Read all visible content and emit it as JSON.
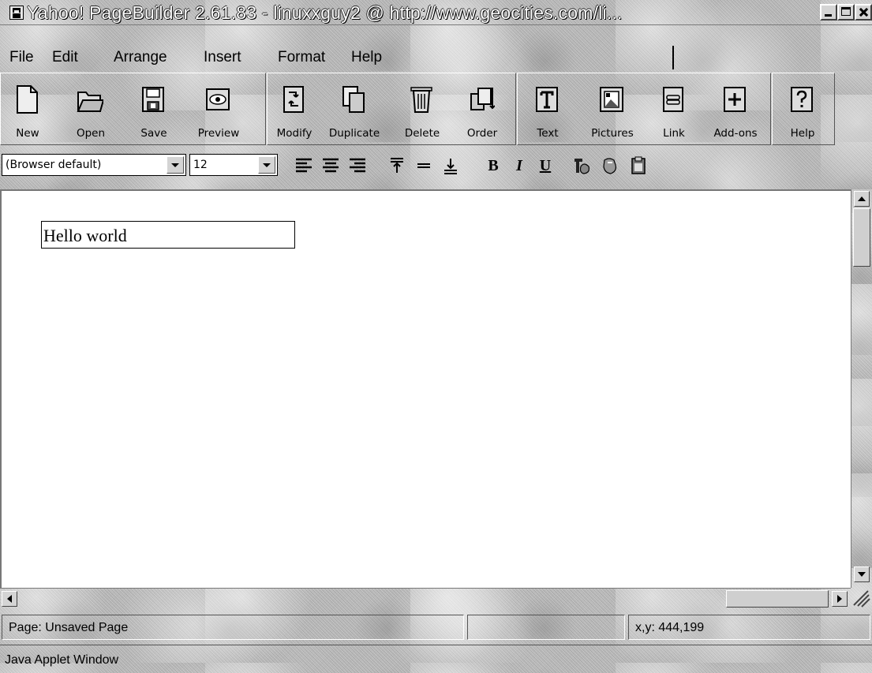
{
  "window": {
    "title": "Yahoo! PageBuilder 2.61.83 - linuxxguy2 @ http://www.geocities.com/li...",
    "icon": "house-icon"
  },
  "menu": {
    "items": [
      {
        "label": "File"
      },
      {
        "label": "Edit"
      },
      {
        "label": "Arrange"
      },
      {
        "label": "Insert"
      },
      {
        "label": "Format"
      },
      {
        "label": "Help"
      }
    ]
  },
  "toolbar": {
    "groups": [
      [
        {
          "label": "New",
          "icon": "new-page-icon"
        },
        {
          "label": "Open",
          "icon": "open-folder-icon"
        },
        {
          "label": "Save",
          "icon": "save-disk-icon"
        },
        {
          "label": "Preview",
          "icon": "preview-eye-icon"
        }
      ],
      [
        {
          "label": "Modify",
          "icon": "modify-icon"
        },
        {
          "label": "Duplicate",
          "icon": "duplicate-icon"
        },
        {
          "label": "Delete",
          "icon": "trash-icon"
        },
        {
          "label": "Order",
          "icon": "order-icon"
        }
      ],
      [
        {
          "label": "Text",
          "icon": "text-icon"
        },
        {
          "label": "Pictures",
          "icon": "picture-icon"
        },
        {
          "label": "Link",
          "icon": "link-icon"
        },
        {
          "label": "Add-ons",
          "icon": "add-ons-icon"
        }
      ],
      [
        {
          "label": "Help",
          "icon": "help-question-icon"
        }
      ]
    ]
  },
  "format": {
    "font": {
      "value": "(Browser default)"
    },
    "size": {
      "value": "12"
    },
    "bold": "B",
    "italic": "I",
    "underline": "U"
  },
  "canvas": {
    "textbox": {
      "text": "Hello world"
    }
  },
  "status": {
    "page": "Page: Unsaved Page",
    "coords": "x,y: 444,199"
  },
  "applet_warning": "Java Applet Window"
}
